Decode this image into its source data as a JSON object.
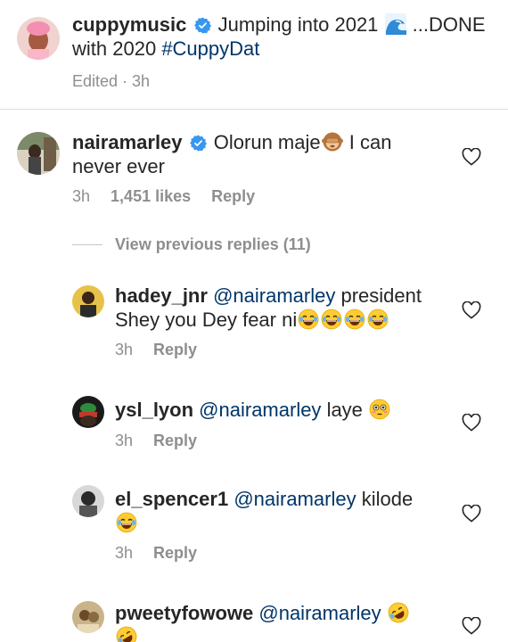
{
  "post": {
    "username": "cuppymusic",
    "caption_line1": "Jumping into 2021",
    "caption_tail": "...DONE",
    "caption_line2": "with 2020",
    "hashtag": "#CuppyDat",
    "meta": "Edited · 3h"
  },
  "comment": {
    "username": "nairamarley",
    "text_a": "Olorun maje",
    "text_b": "I can",
    "text_c": "never ever",
    "time": "3h",
    "likes": "1,451 likes",
    "reply": "Reply"
  },
  "view_replies": "View previous replies (11)",
  "replies": [
    {
      "username": "hadey_jnr",
      "mention": "@nairamarley",
      "text_line1": "president",
      "text_line2": "Shey you Dey fear ni",
      "time": "3h",
      "reply": "Reply"
    },
    {
      "username": "ysl_lyon",
      "mention": "@nairamarley",
      "text_line1": "laye",
      "time": "3h",
      "reply": "Reply"
    },
    {
      "username": "el_spencer1",
      "mention": "@nairamarley",
      "text_line1": "kilode",
      "time": "3h",
      "reply": "Reply"
    },
    {
      "username": "pweetyfowowe",
      "mention": "@nairamarley",
      "time": "",
      "reply": ""
    }
  ],
  "icons": {
    "verified": "verified-badge-icon",
    "heart": "heart-outline-icon",
    "wave": "water-wave-emoji",
    "monkey": "see-no-evil-monkey-emoji",
    "laugh": "tears-of-joy-emoji",
    "flushed": "flushed-face-emoji",
    "rofl": "rolling-on-floor-laughing-emoji"
  },
  "colors": {
    "text": "#262626",
    "muted": "#8e8e8e",
    "verified": "#3897f0",
    "mention": "#003569"
  }
}
